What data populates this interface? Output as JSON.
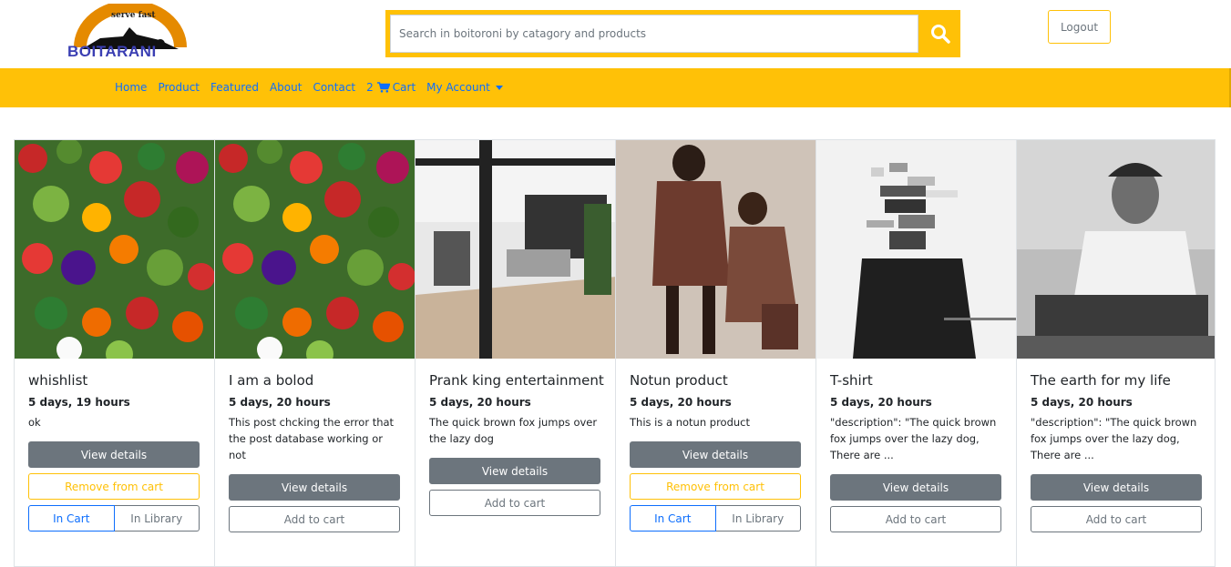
{
  "brand": {
    "tagline": "serve fast",
    "name": "BOITARANI"
  },
  "search": {
    "placeholder": "Search in boitoroni by catagory and products",
    "value": "",
    "icon": "search-icon"
  },
  "header": {
    "logout_label": "Logout"
  },
  "nav": {
    "items": [
      "Home",
      "Product",
      "Featured",
      "About",
      "Contact"
    ],
    "cart_count": "2",
    "cart_label": "Cart",
    "cart_icon": "cart-icon",
    "account_label": "My Account"
  },
  "colors": {
    "accent": "#ffc107",
    "link": "#0d6efd",
    "secondary": "#6c757d"
  },
  "products": [
    {
      "title": "whishlist",
      "time": "5 days, 19 hours",
      "description": "ok",
      "image": "vegetables-photo",
      "view_label": "View details",
      "in_cart": true,
      "remove_label": "Remove from cart",
      "in_cart_label": "In Cart",
      "in_library_label": "In Library"
    },
    {
      "title": "I am a bolod",
      "time": "5 days, 20 hours",
      "description": "This post chcking the error that the post database working or not",
      "image": "vegetables-photo",
      "view_label": "View details",
      "in_cart": false,
      "add_label": "Add to cart"
    },
    {
      "title": "Prank king entertainment",
      "time": "5 days, 20 hours",
      "description": "The quick brown fox jumps over the lazy dog",
      "image": "patio-photo",
      "view_label": "View details",
      "in_cart": false,
      "add_label": "Add to cart"
    },
    {
      "title": "Notun product",
      "time": "5 days, 20 hours",
      "description": "This is a notun product",
      "image": "fashion-models-photo",
      "view_label": "View details",
      "in_cart": true,
      "remove_label": "Remove from cart",
      "in_cart_label": "In Cart",
      "in_library_label": "In Library"
    },
    {
      "title": "T-shirt",
      "time": "5 days, 20 hours",
      "description": "\"description\": \"The quick brown fox jumps over the lazy dog, There are ...",
      "image": "pixelated-man-photo",
      "view_label": "View details",
      "in_cart": false,
      "add_label": "Add to cart"
    },
    {
      "title": "The earth for my life",
      "time": "5 days, 20 hours",
      "description": "\"description\": \"The quick brown fox jumps over the lazy dog, There are ...",
      "image": "man-portrait-photo",
      "view_label": "View details",
      "in_cart": false,
      "add_label": "Add to cart"
    }
  ]
}
